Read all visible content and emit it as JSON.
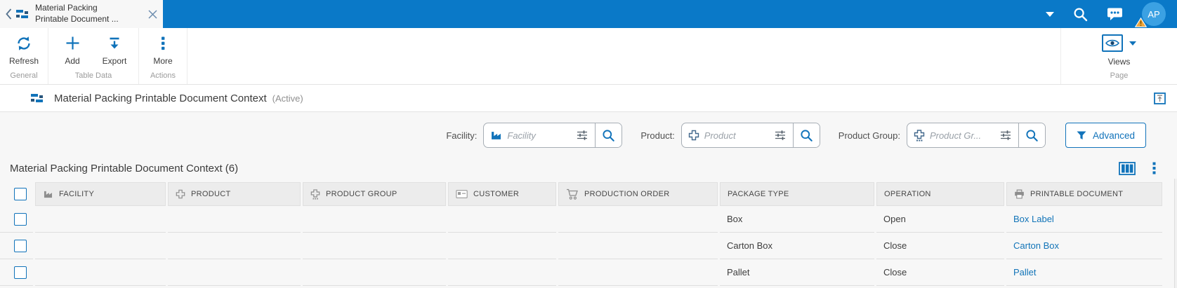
{
  "colors": {
    "topbar_blue": "#0a79c8",
    "accent_blue": "#1173ba",
    "link_blue": "#1274b8",
    "avatar_blue": "#3ba1e3",
    "warning_yellow": "#f0a63a",
    "page_bg": "#f7f7f7"
  },
  "topbar": {
    "back_icon": "chevron-left-icon",
    "tab": {
      "icon": "screen-icon",
      "title_line1": "Material Packing",
      "title_line2": "Printable Document ...",
      "close_icon": "close-icon"
    },
    "right": {
      "menu_icon": "chevron-down-icon",
      "search_icon": "search-icon",
      "messages_icon": "chat-icon",
      "avatar_initials": "AP",
      "warning_icon": "warning-icon"
    }
  },
  "toolbar": {
    "groups": [
      {
        "label": "General",
        "buttons": [
          {
            "label": "Refresh",
            "icon": "refresh-icon"
          }
        ]
      },
      {
        "label": "Table Data",
        "buttons": [
          {
            "label": "Add",
            "icon": "plus-icon"
          },
          {
            "label": "Export",
            "icon": "export-icon"
          }
        ]
      },
      {
        "label": "Actions",
        "buttons": [
          {
            "label": "More",
            "icon": "kebab-icon"
          }
        ]
      }
    ],
    "page_group": {
      "label": "Page",
      "views_button": {
        "label": "Views",
        "icon": "eye-icon",
        "dropdown_icon": "chevron-down-icon"
      }
    }
  },
  "page_header": {
    "icon": "screen-icon",
    "title": "Material Packing Printable Document Context",
    "status": "(Active)",
    "restore_icon": "restore-icon"
  },
  "filters": {
    "facility": {
      "label": "Facility:",
      "placeholder": "Facility",
      "icon": "factory-icon"
    },
    "product": {
      "label": "Product:",
      "placeholder": "Product",
      "icon": "product-icon"
    },
    "product_group": {
      "label": "Product Group:",
      "placeholder": "Product Gr...",
      "icon": "product-group-icon"
    },
    "advanced_button": {
      "label": "Advanced",
      "icon": "funnel-icon"
    }
  },
  "table": {
    "title": "Material Packing Printable Document Context (6)",
    "toolbar_icons": [
      "columns-icon",
      "kebab-icon"
    ],
    "columns": [
      {
        "label": "FACILITY",
        "icon": "factory-icon"
      },
      {
        "label": "PRODUCT",
        "icon": "product-icon"
      },
      {
        "label": "PRODUCT GROUP",
        "icon": "product-group-icon"
      },
      {
        "label": "CUSTOMER",
        "icon": "id-card-icon"
      },
      {
        "label": "PRODUCTION ORDER",
        "icon": "cart-icon"
      },
      {
        "label": "PACKAGE TYPE",
        "icon": null
      },
      {
        "label": "OPERATION",
        "icon": null
      },
      {
        "label": "PRINTABLE DOCUMENT",
        "icon": "printer-icon"
      }
    ],
    "rows": [
      {
        "facility": "",
        "product": "",
        "product_group": "",
        "customer": "",
        "production_order": "",
        "package_type": "Box",
        "operation": "Open",
        "printable_document": "Box Label"
      },
      {
        "facility": "",
        "product": "",
        "product_group": "",
        "customer": "",
        "production_order": "",
        "package_type": "Carton Box",
        "operation": "Close",
        "printable_document": "Carton Box"
      },
      {
        "facility": "",
        "product": "",
        "product_group": "",
        "customer": "",
        "production_order": "",
        "package_type": "Pallet",
        "operation": "Close",
        "printable_document": "Pallet"
      }
    ]
  }
}
